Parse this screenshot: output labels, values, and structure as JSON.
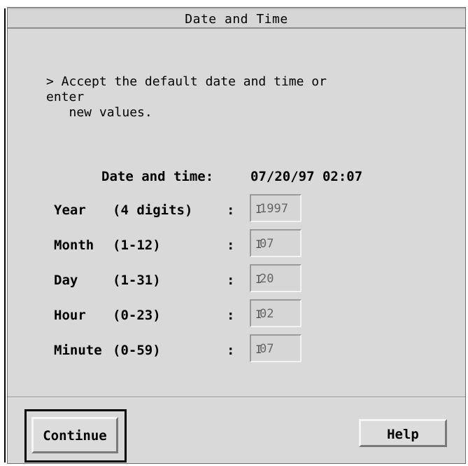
{
  "window": {
    "title": "Date and Time"
  },
  "instructions": "> Accept the default date and time or\nenter\n   new values.",
  "summary": {
    "label": "Date and time:",
    "value": "07/20/97 02:07"
  },
  "fields": [
    {
      "name": "Year",
      "range": "(4 digits)",
      "colon": ":",
      "value": "1997"
    },
    {
      "name": "Month",
      "range": "(1-12)",
      "colon": ":",
      "value": "07"
    },
    {
      "name": "Day",
      "range": "(1-31)",
      "colon": ":",
      "value": "20"
    },
    {
      "name": "Hour",
      "range": "(0-23)",
      "colon": ":",
      "value": "02"
    },
    {
      "name": "Minute",
      "range": "(0-59)",
      "colon": ":",
      "value": "07"
    }
  ],
  "buttons": {
    "continue": "Continue",
    "help": "Help"
  }
}
